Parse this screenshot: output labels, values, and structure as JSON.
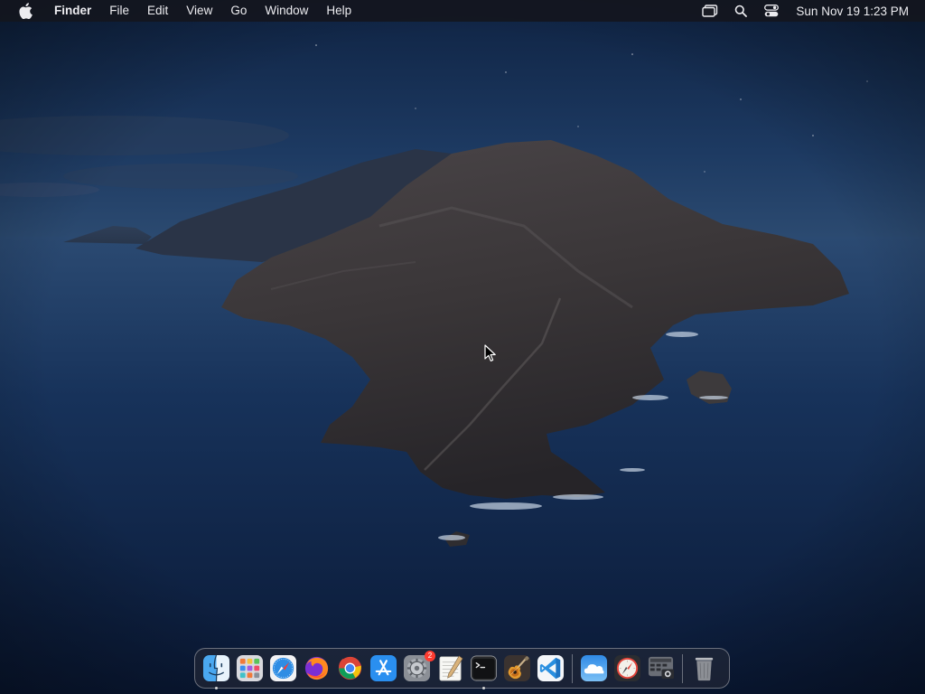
{
  "menubar": {
    "apple_icon": "apple-logo-icon",
    "app_name": "Finder",
    "items": [
      {
        "label": "File"
      },
      {
        "label": "Edit"
      },
      {
        "label": "View"
      },
      {
        "label": "Go"
      },
      {
        "label": "Window"
      },
      {
        "label": "Help"
      }
    ],
    "status_icons": [
      "screen-mirroring-icon",
      "spotlight-search-icon",
      "control-center-icon"
    ],
    "clock": "Sun Nov 19  1:23 PM"
  },
  "dock": {
    "items": [
      {
        "name": "Finder",
        "icon": "finder-icon",
        "running": true
      },
      {
        "name": "Launchpad",
        "icon": "launchpad-icon",
        "running": false
      },
      {
        "name": "Safari",
        "icon": "safari-icon",
        "running": false
      },
      {
        "name": "Firefox",
        "icon": "firefox-icon",
        "running": false
      },
      {
        "name": "Google Chrome",
        "icon": "chrome-icon",
        "running": false
      },
      {
        "name": "App Store",
        "icon": "app-store-icon",
        "running": false
      },
      {
        "name": "System Preferences",
        "icon": "system-preferences-icon",
        "running": false,
        "badge": "2"
      },
      {
        "name": "TextEdit",
        "icon": "textedit-icon",
        "running": false
      },
      {
        "name": "Terminal",
        "icon": "terminal-icon",
        "running": true
      },
      {
        "name": "Xcode Instruments",
        "icon": "guitar-icon",
        "running": false
      },
      {
        "name": "Visual Studio Code",
        "icon": "vscode-icon",
        "running": false
      },
      {
        "name": "Weather",
        "icon": "weather-icon",
        "running": false
      },
      {
        "name": "Compass",
        "icon": "compass-icon",
        "running": false
      },
      {
        "name": "Screenshot",
        "icon": "screenshot-icon",
        "running": false
      },
      {
        "name": "Trash",
        "icon": "trash-icon",
        "running": false
      }
    ]
  },
  "colors": {
    "menubar_bg": "#14161e",
    "sea_dark": "#0a1a36",
    "sky_top": "#0d1f3d",
    "island_rock": "#3c3a3f",
    "badge_red": "#ff3b30",
    "vscode_blue": "#2a8fe0"
  }
}
